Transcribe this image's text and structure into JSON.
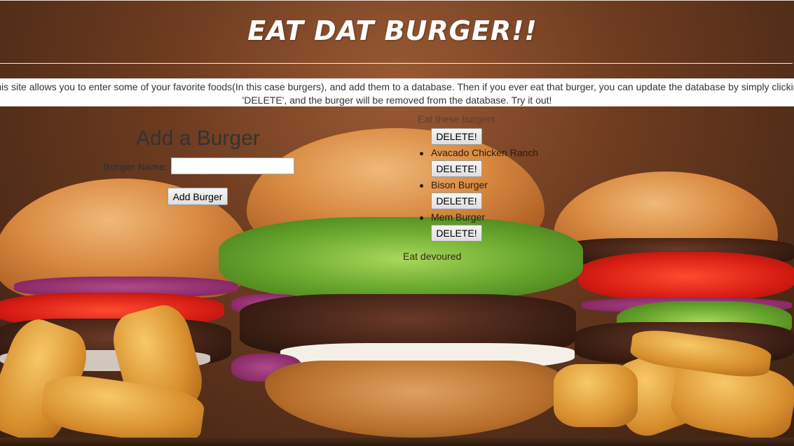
{
  "header": {
    "title": "EAT DAT BURGER!!"
  },
  "description": {
    "text": "This site allows you to enter some of your favorite foods(In this case burgers), and add them to a database. Then if you ever eat that burger, you can update the database by simply clicking 'DELETE', and the burger will be removed from the database. Try it out!"
  },
  "form": {
    "title": "Add a Burger",
    "name_label": "Burger Name:",
    "name_value": "",
    "submit_label": "Add Burger"
  },
  "burgers": {
    "heading": "Eat these burgers",
    "delete_label": "DELETE!",
    "items": [
      {
        "name": ""
      },
      {
        "name": "Avacado Chicken Ranch"
      },
      {
        "name": "Bison Burger"
      },
      {
        "name": "Mem Burger"
      }
    ]
  },
  "devoured": {
    "heading": "Eat devoured"
  },
  "colors": {
    "header_text": "#ffffff",
    "description_bg": "#ffffff",
    "text": "#333333"
  }
}
